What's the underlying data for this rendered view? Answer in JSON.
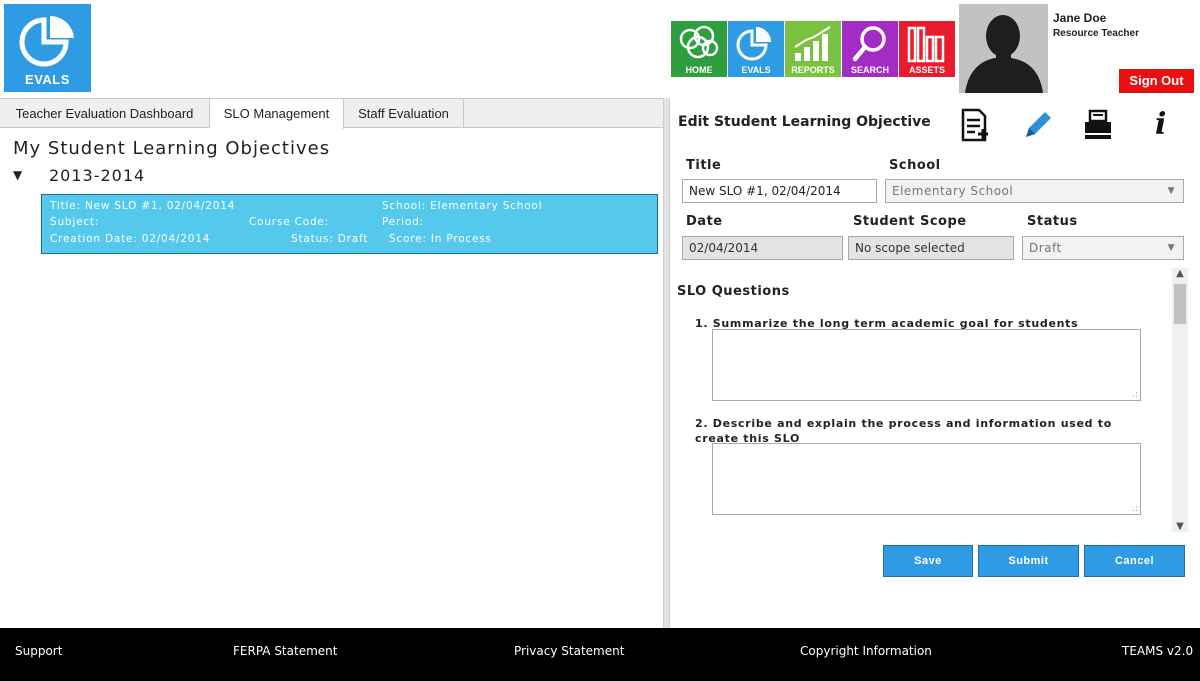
{
  "header": {
    "logo_label": "EVALS",
    "nav": [
      {
        "label": "HOME",
        "color": "#2e9e3e",
        "icon": "home-globe-icon"
      },
      {
        "label": "EVALS",
        "color": "#2e9be4",
        "icon": "evals-pie-icon"
      },
      {
        "label": "REPORTS",
        "color": "#7cc242",
        "icon": "reports-bar-chart-icon"
      },
      {
        "label": "SEARCH",
        "color": "#a32cc4",
        "icon": "search-icon"
      },
      {
        "label": "ASSETS",
        "color": "#e81c2c",
        "icon": "assets-books-icon"
      }
    ],
    "user": {
      "name": "Jane Doe",
      "role": "Resource Teacher"
    },
    "signout_label": "Sign Out"
  },
  "left": {
    "tabs": [
      "Teacher Evaluation Dashboard",
      "SLO Management",
      "Staff Evaluation"
    ],
    "active_tab": 1,
    "title": "My Student Learning Objectives",
    "year_toggle": "▼",
    "year": "2013-2014",
    "slo_item": {
      "title": "Title: New SLO #1, 02/04/2014",
      "school": "School: Elementary School",
      "subject": "Subject:",
      "course_code": "Course Code:",
      "period": "Period:",
      "creation_date": "Creation Date: 02/04/2014",
      "status": "Status: Draft",
      "score": "Score: In Process"
    }
  },
  "right": {
    "title": "Edit Student Learning Objective",
    "tools": [
      "new-document-icon",
      "edit-pencil-icon",
      "print-icon",
      "info-icon"
    ],
    "info_glyph": "i",
    "fields": {
      "title_label": "Title",
      "title_value": "New SLO #1, 02/04/2014",
      "school_label": "School",
      "school_value": "Elementary School",
      "date_label": "Date",
      "date_value": "02/04/2014",
      "scope_label": "Student Scope",
      "scope_value": "No scope selected",
      "status_label": "Status",
      "status_value": "Draft"
    },
    "questions_heading": "SLO Questions",
    "questions": [
      "1. Summarize the long term academic goal for students",
      "2. Describe and explain the process and information used to create this SLO"
    ],
    "buttons": {
      "save": "Save",
      "submit": "Submit",
      "cancel": "Cancel"
    }
  },
  "footer": {
    "support": "Support",
    "ferpa": "FERPA Statement",
    "privacy": "Privacy Statement",
    "copyright": "Copyright Information",
    "version": "TEAMS v2.0"
  }
}
